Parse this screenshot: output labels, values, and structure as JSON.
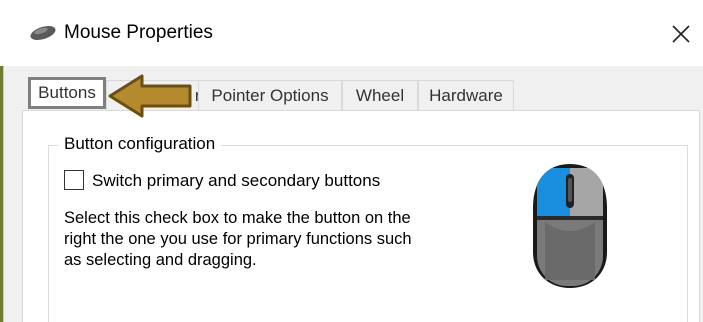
{
  "window": {
    "title": "Mouse Properties",
    "close_glyph": "✕"
  },
  "tabs": [
    {
      "label": "Buttons",
      "active": true
    },
    {
      "label": "Pointers",
      "visible_fragment": "rs"
    },
    {
      "label": "Pointer Options"
    },
    {
      "label": "Wheel"
    },
    {
      "label": "Hardware"
    }
  ],
  "button_configuration": {
    "group_title": "Button configuration",
    "checkbox_label": "Switch primary and secondary buttons",
    "checkbox_checked": false,
    "description_lines": [
      "Select this check box to make the button on the",
      "right the one you use for primary functions such",
      "as selecting and dragging."
    ]
  },
  "icons": {
    "app": "mouse-icon",
    "close": "close-icon",
    "annotation": "arrow-pointer-icon",
    "illustration": "mouse-illustration"
  },
  "colors": {
    "arrow_fill": "#b48a2e",
    "arrow_stroke": "#6b4f12",
    "mouse_primary_button": "#1a8fe0",
    "mouse_secondary_button": "#a6a6a6",
    "mouse_body": "#7a7a7a"
  }
}
